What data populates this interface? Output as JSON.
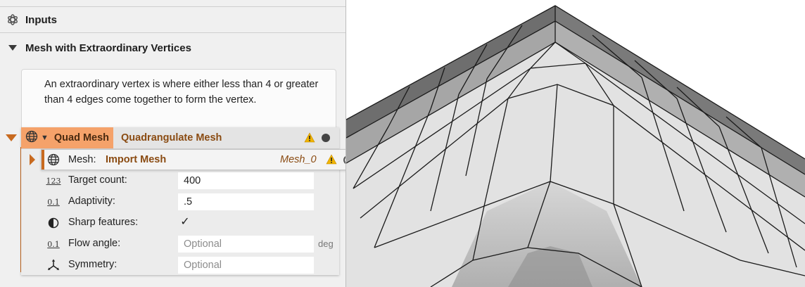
{
  "panel": {
    "inputs_header": {
      "label": "Inputs",
      "icon": "gear-flower-icon"
    },
    "mesh_header": {
      "label": "Mesh with Extraordinary Vertices",
      "icon": "chevron-down-icon"
    },
    "description": "An extraordinary vertex is where either less than 4 or greater than 4 edges come together to form the vertex."
  },
  "node": {
    "icon": "globe-icon",
    "title": "Quad Mesh",
    "operation": "Quadrangulate Mesh",
    "status": "warning",
    "input": {
      "label": "Mesh:",
      "operation": "Import Mesh",
      "value": "Mesh_0",
      "status": "warning"
    },
    "params": [
      {
        "key": "target-count",
        "icon": "number-123-icon",
        "icon_text": "123",
        "label": "Target count:",
        "value": "400",
        "placeholder": ""
      },
      {
        "key": "adaptivity",
        "icon": "decimal-icon",
        "icon_text": "0.1",
        "label": "Adaptivity:",
        "value": ".5",
        "placeholder": ""
      },
      {
        "key": "sharp-features",
        "icon": "half-circle-icon",
        "icon_text": "◑",
        "label": "Sharp features:",
        "check": "✓"
      },
      {
        "key": "flow-angle",
        "icon": "decimal-icon",
        "icon_text": "0.1",
        "label": "Flow angle:",
        "value": "",
        "placeholder": "Optional",
        "unit": "deg"
      },
      {
        "key": "symmetry",
        "icon": "axes-icon",
        "icon_text": "",
        "label": "Symmetry:",
        "value": "",
        "placeholder": "Optional"
      }
    ]
  },
  "colors": {
    "accent": "#c86a1f",
    "node_chip": "#f5a26a",
    "operation_text": "#8a4b12",
    "warning": "#f0b400"
  }
}
